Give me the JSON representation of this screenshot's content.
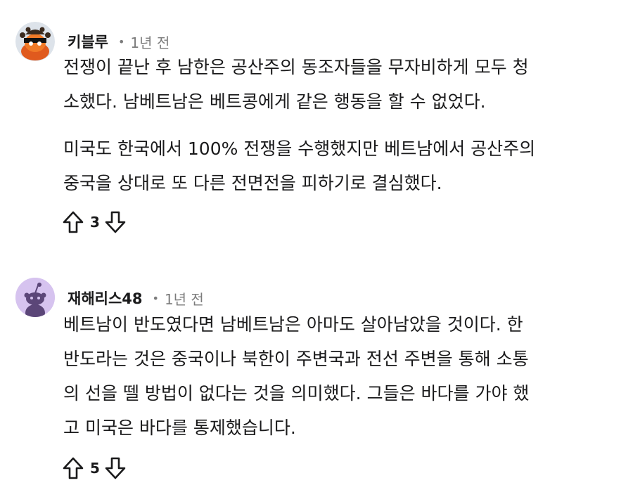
{
  "comments": [
    {
      "username": "키블루",
      "separator": "•",
      "time": "1년 전",
      "paragraphs": [
        [
          "전쟁이 끝난 후 남한은 공산주의 동조자들을 무자비하게 모두 청",
          "소했다. 남베트남은 베트콩에게 같은 행동을 할 수 없었다."
        ],
        [
          "미국도 한국에서 100% 전쟁을 수행했지만 베트남에서 공산주의",
          "중국을 상대로 또 다른 전면전을 피하기로 결심했다."
        ]
      ],
      "score": "3",
      "avatar_icon": "pirate-avatar-icon"
    },
    {
      "username": "재해리스48",
      "separator": "•",
      "time": "1년 전",
      "paragraphs": [
        [
          "베트남이 반도였다면 남베트남은 아마도 살아남았을 것이다. 한",
          "반도라는 것은 중국이나 북한이 주변국과 전선 주변을 통해 소통",
          "의 선을 뗄 방법이 없다는 것을 의미했다. 그들은 바다를 가야 했",
          "고 미국은 바다를 통제했습니다."
        ]
      ],
      "score": "5",
      "avatar_icon": "snoo-avatar-icon"
    }
  ],
  "colors": {
    "text": "#1a1a1b",
    "meta": "#7c7c7c",
    "avatar2_bg": "#d6c3ef"
  }
}
